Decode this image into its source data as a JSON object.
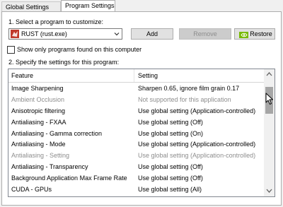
{
  "tabs": [
    {
      "label": "Global Settings",
      "selected": false
    },
    {
      "label": "Program Settings",
      "selected": true
    }
  ],
  "step1": {
    "label": "1. Select a program to customize:"
  },
  "program_select": {
    "value": "RUST (rust.exe)",
    "icon": "rust-app-icon"
  },
  "buttons": {
    "add": "Add",
    "remove": "Remove",
    "restore": "Restore",
    "restore_icon": "nvidia-logo-icon"
  },
  "show_only_checkbox": {
    "label": "Show only programs found on this computer",
    "checked": false
  },
  "step2": {
    "label": "2. Specify the settings for this program:"
  },
  "table": {
    "headers": [
      "Feature",
      "Setting"
    ],
    "rows": [
      {
        "feature": "Image Sharpening",
        "setting": "Sharpen 0.65, ignore film grain 0.17",
        "disabled": false
      },
      {
        "feature": "Ambient Occlusion",
        "setting": "Not supported for this application",
        "disabled": true
      },
      {
        "feature": "Anisotropic filtering",
        "setting": "Use global setting (Application-controlled)",
        "disabled": false
      },
      {
        "feature": "Antialiasing - FXAA",
        "setting": "Use global setting (Off)",
        "disabled": false
      },
      {
        "feature": "Antialiasing - Gamma correction",
        "setting": "Use global setting (On)",
        "disabled": false
      },
      {
        "feature": "Antialiasing - Mode",
        "setting": "Use global setting (Application-controlled)",
        "disabled": false
      },
      {
        "feature": "Antialiasing - Setting",
        "setting": "Use global setting (Application-controlled)",
        "disabled": true
      },
      {
        "feature": "Antialiasing - Transparency",
        "setting": "Use global setting (Off)",
        "disabled": false
      },
      {
        "feature": "Background Application Max Frame Rate",
        "setting": "Use global setting (Off)",
        "disabled": false
      },
      {
        "feature": "CUDA - GPUs",
        "setting": "Use global setting (All)",
        "disabled": false
      }
    ]
  },
  "colors": {
    "accent_green": "#76b900",
    "rust_red": "#c0392b",
    "disabled_text": "#8d8d8d"
  }
}
